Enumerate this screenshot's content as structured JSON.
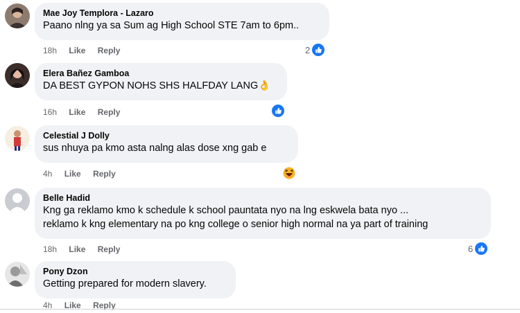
{
  "comments": [
    {
      "author": "Mae Joy Templora - Lazaro",
      "lines": [
        "Paano nlng ya sa Sum ag High School STE 7am to 6pm.."
      ],
      "time": "18h",
      "like_label": "Like",
      "reply_label": "Reply",
      "reaction_count": "2",
      "reaction": "like-icon"
    },
    {
      "author": "Elera Bañez Gamboa",
      "lines": [
        "DA BEST GYPON NOHS SHS HALFDAY LANG👌"
      ],
      "time": "16h",
      "like_label": "Like",
      "reply_label": "Reply",
      "reaction_count": "",
      "reaction": "like-icon"
    },
    {
      "author": "Celestial J Dolly",
      "lines": [
        "sus nhuya pa kmo asta nalng alas dose xng gab e"
      ],
      "time": "4h",
      "like_label": "Like",
      "reply_label": "Reply",
      "reaction_count": "",
      "reaction": "haha-icon"
    },
    {
      "author": "Belle Hadid",
      "lines": [
        "Kng ga reklamo kmo k schedule k school pauntata nyo na lng eskwela bata nyo ...",
        "reklamo k kng elementary na po kng college o senior high normal na ya part of training"
      ],
      "time": "18h",
      "like_label": "Like",
      "reply_label": "Reply",
      "reaction_count": "6",
      "reaction": "like-icon"
    },
    {
      "author": "Pony Dzon",
      "lines": [
        "Getting prepared for modern slavery."
      ],
      "time": "4h",
      "like_label": "Like",
      "reply_label": "Reply",
      "reaction_count": "",
      "reaction": ""
    }
  ],
  "colors": {
    "bubble": "#f0f2f5",
    "meta_text": "#65676b",
    "like_blue": "#1877f2",
    "haha_yellow": "#f7b125"
  }
}
